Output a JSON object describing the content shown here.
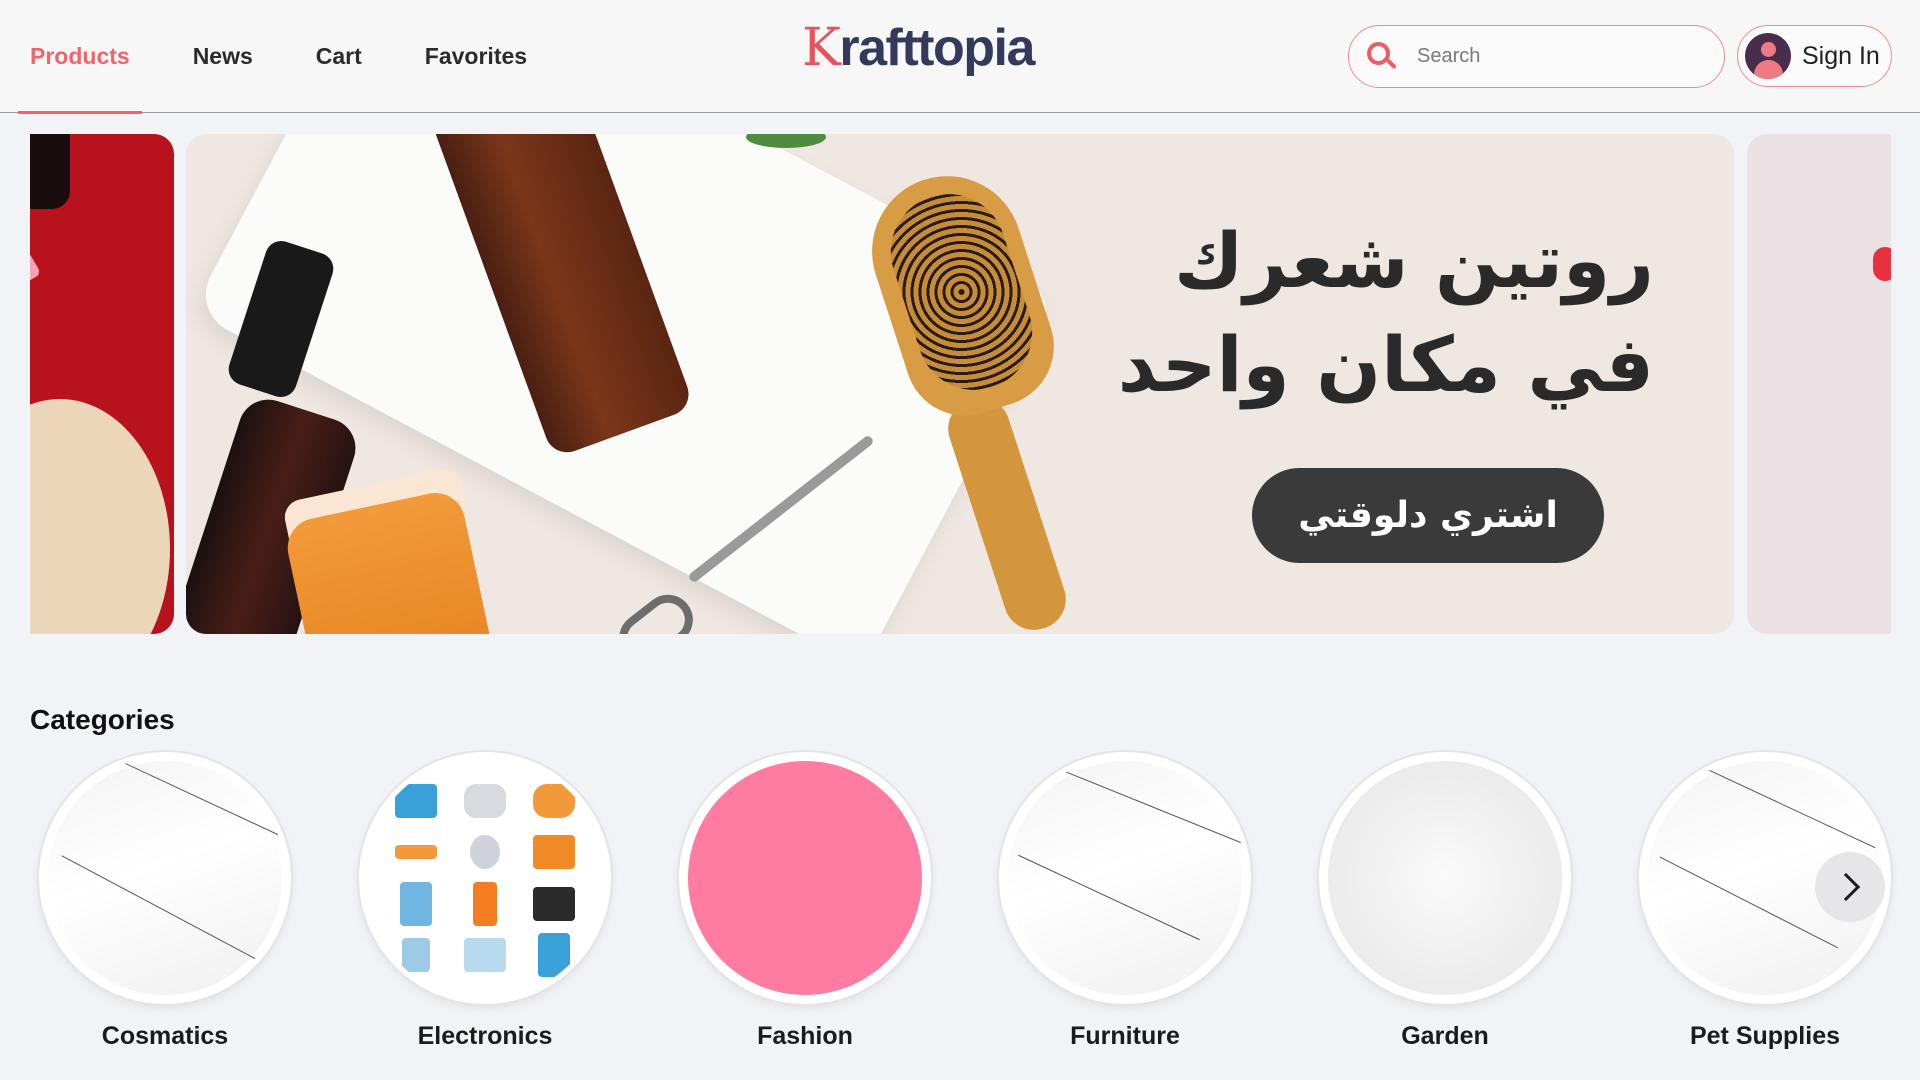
{
  "header": {
    "nav": [
      {
        "label": "Products",
        "active": true
      },
      {
        "label": "News",
        "active": false
      },
      {
        "label": "Cart",
        "active": false
      },
      {
        "label": "Favorites",
        "active": false
      }
    ],
    "logo": {
      "first_letter": "K",
      "rest": "rafttopia"
    },
    "search": {
      "placeholder": "Search"
    },
    "signin_label": "Sign In"
  },
  "banner": {
    "headline_line1": "روتين شعرك",
    "headline_line2": "في مكان واحد",
    "cta_label": "اشتري دلوقتي"
  },
  "categories": {
    "title": "Categories",
    "items": [
      {
        "label": "Cosmatics"
      },
      {
        "label": "Electronics"
      },
      {
        "label": "Fashion"
      },
      {
        "label": "Furniture"
      },
      {
        "label": "Garden"
      },
      {
        "label": "Pet Supplies"
      }
    ]
  },
  "colors": {
    "accent": "#f0646a",
    "logo_dark": "#333a5c",
    "fashion_pink": "#fe7ca1",
    "cta_dark": "#3a3a3a"
  }
}
